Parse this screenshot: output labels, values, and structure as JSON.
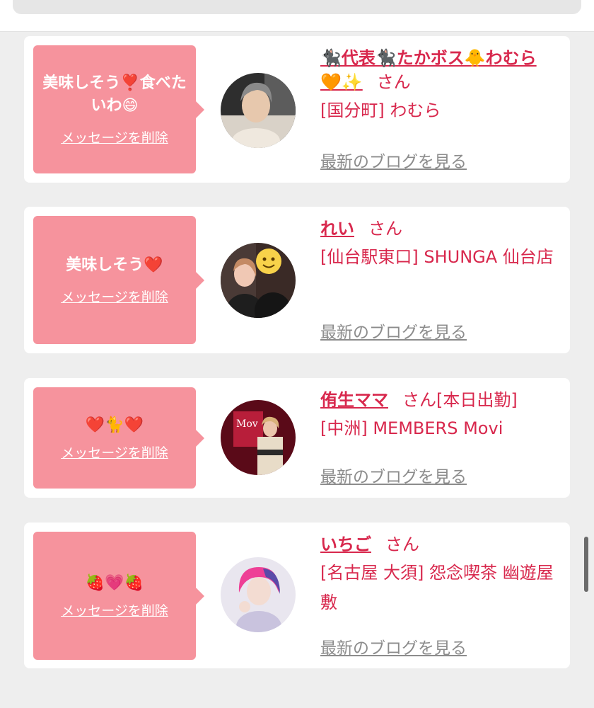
{
  "messages": [
    {
      "message": "美味しそう❣️食べたいわ😄",
      "delete_label": "メッセージを削除",
      "name": "🐈‍⬛代表🐈‍⬛たかボス🐥わむら🧡✨",
      "honorific": "さん",
      "extra": "",
      "shop": "[国分町] わむら",
      "blog_label": "最新のブログを見る"
    },
    {
      "message": "美味しそう❤️",
      "delete_label": "メッセージを削除",
      "name": "れい",
      "honorific": "さん",
      "extra": "",
      "shop": "[仙台駅東口] SHUNGA 仙台店",
      "blog_label": "最新のブログを見る"
    },
    {
      "message": "❤️🐈❤️",
      "delete_label": "メッセージを削除",
      "name": "侑生ママ",
      "honorific": "さん",
      "extra": "[本日出勤]",
      "shop": "[中洲] MEMBERS Movi",
      "blog_label": "最新のブログを見る"
    },
    {
      "message": "🍓💗🍓",
      "delete_label": "メッセージを削除",
      "name": "いちご",
      "honorific": "さん",
      "extra": "",
      "shop": "[名古屋 大須] 怨念喫茶 幽遊屋敷",
      "blog_label": "最新のブログを見る"
    }
  ],
  "colors": {
    "bubble": "#f6939d",
    "accent": "#d8284d",
    "link_gray": "#8c8c8c",
    "background": "#eeeeee"
  }
}
